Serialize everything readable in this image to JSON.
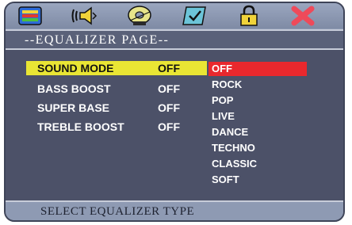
{
  "toolbar": {
    "icons": [
      "picture-settings-icon",
      "audio-speaker-icon",
      "disc-icon",
      "preference-checkbox-icon",
      "lock-icon",
      "exit-icon"
    ]
  },
  "page": {
    "title": "--EQUALIZER PAGE--"
  },
  "settings": [
    {
      "label": "SOUND MODE",
      "value": "OFF",
      "selected": true
    },
    {
      "label": "BASS BOOST",
      "value": "OFF"
    },
    {
      "label": "SUPER BASE",
      "value": "OFF"
    },
    {
      "label": "TREBLE BOOST",
      "value": "OFF"
    }
  ],
  "options": [
    "OFF",
    "ROCK",
    "POP",
    "LIVE",
    "DANCE",
    "TECHNO",
    "CLASSIC",
    "SOFT"
  ],
  "selected_option": "OFF",
  "status": {
    "text": "SELECT EQUALIZER TYPE"
  },
  "colors": {
    "frame": "#8e9ab3",
    "panel": "#4c5168",
    "title_bar": "#5a6179",
    "highlight": "#e9e534",
    "selected_option": "#e9282d"
  }
}
